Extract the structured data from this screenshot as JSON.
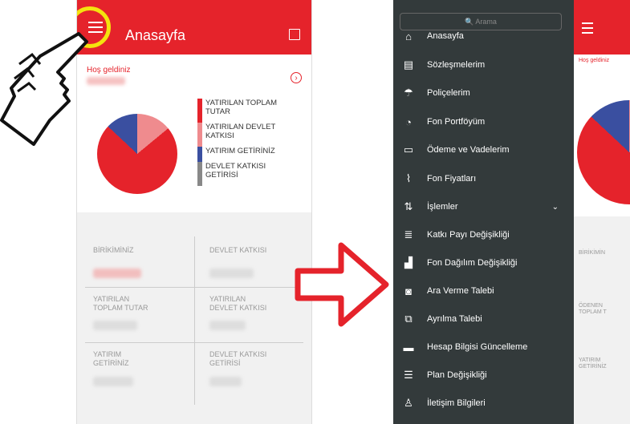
{
  "screen1": {
    "header": {
      "title": "Anasayfa"
    },
    "welcome": "Hoş geldiniz",
    "legend": [
      {
        "label": "YATIRILAN TOPLAM TUTAR",
        "color": "#e5232b"
      },
      {
        "label": "YATIRILAN DEVLET KATKISI",
        "color": "#ef8b8e"
      },
      {
        "label": "YATIRIM GETİRİNİZ",
        "color": "#3a4fa0"
      },
      {
        "label": "DEVLET KATKISI GETİRİSİ",
        "color": "#888888"
      }
    ],
    "cells": {
      "birikiminiz": "BİRİKİMİNİZ",
      "devlet_katkisi": "DEVLET KATKISI",
      "yatirilan_toplam": "YATIRILAN\nTOPLAM TUTAR",
      "yatirilan_devlet": "YATIRILAN\nDEVLET KATKISI",
      "yatirim_getiriniz": "YATIRIM\nGETİRİNİZ",
      "devlet_getirisi": "DEVLET KATKISI\nGETİRİSİ"
    }
  },
  "screen2": {
    "search_placeholder": "Arama",
    "menu": [
      {
        "label": "Anasayfa",
        "icon": "home-icon"
      },
      {
        "label": "Sözleşmelerim",
        "icon": "document-icon"
      },
      {
        "label": "Poliçelerim",
        "icon": "umbrella-icon"
      },
      {
        "label": "Fon Portföyüm",
        "icon": "pie-icon"
      },
      {
        "label": "Ödeme ve Vadelerim",
        "icon": "payment-icon"
      },
      {
        "label": "Fon Fiyatları",
        "icon": "chart-icon"
      },
      {
        "label": "İşlemler",
        "icon": "transactions-icon"
      },
      {
        "label": "Katkı Payı Değişikliği",
        "icon": "coins-icon"
      },
      {
        "label": "Fon Dağılım Değişikliği",
        "icon": "bars-icon"
      },
      {
        "label": "Ara Verme Talebi",
        "icon": "pause-icon"
      },
      {
        "label": "Ayrılma Talebi",
        "icon": "exit-icon"
      },
      {
        "label": "Hesap Bilgisi Güncelleme",
        "icon": "card-icon"
      },
      {
        "label": "Plan Değişikliği",
        "icon": "plan-icon"
      },
      {
        "label": "İletişim Bilgileri",
        "icon": "contact-icon"
      }
    ],
    "peek": {
      "welcome": "Hoş geldiniz",
      "birikim": "BİRİKİMİN",
      "odenen": "ÖDENEN\nTOPLAM T",
      "yatirim": "YATIRIM\nGETİRİNİZ"
    }
  }
}
